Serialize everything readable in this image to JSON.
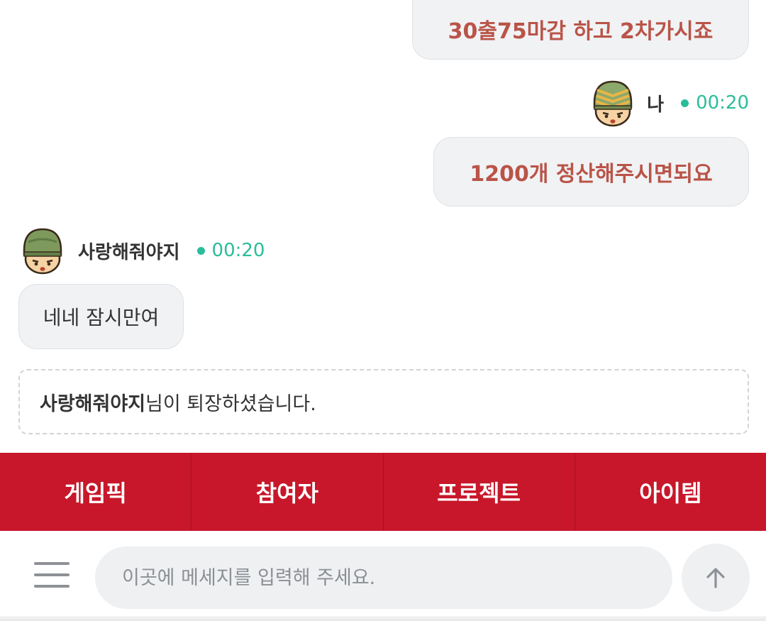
{
  "messages": [
    {
      "sender": "me",
      "text": "30출75마감 하고 2차가시죠"
    },
    {
      "sender": "me",
      "name": "나",
      "time": "00:20",
      "text": "1200개 정산해주시면되요"
    },
    {
      "sender": "other",
      "name": "사랑해줘야지",
      "time": "00:20",
      "text": "네네 잠시만여"
    }
  ],
  "system_notice": {
    "name": "사랑해줘야지",
    "suffix": "님이 퇴장하셨습니다."
  },
  "tabs": [
    {
      "label": "게임픽"
    },
    {
      "label": "참여자"
    },
    {
      "label": "프로젝트"
    },
    {
      "label": "아이템"
    }
  ],
  "input": {
    "placeholder": "이곳에 메세지를 입력해 주세요.",
    "value": ""
  },
  "icons": {
    "menu": "hamburger-menu-icon",
    "send": "arrow-up-icon",
    "avatar_me": "sergeant-soldier-avatar",
    "avatar_other": "soldier-avatar"
  },
  "colors": {
    "accent_red": "#c8172a",
    "online_green": "#2bbd9a",
    "my_message_text": "#b95448",
    "bubble_bg": "#f1f2f4"
  }
}
